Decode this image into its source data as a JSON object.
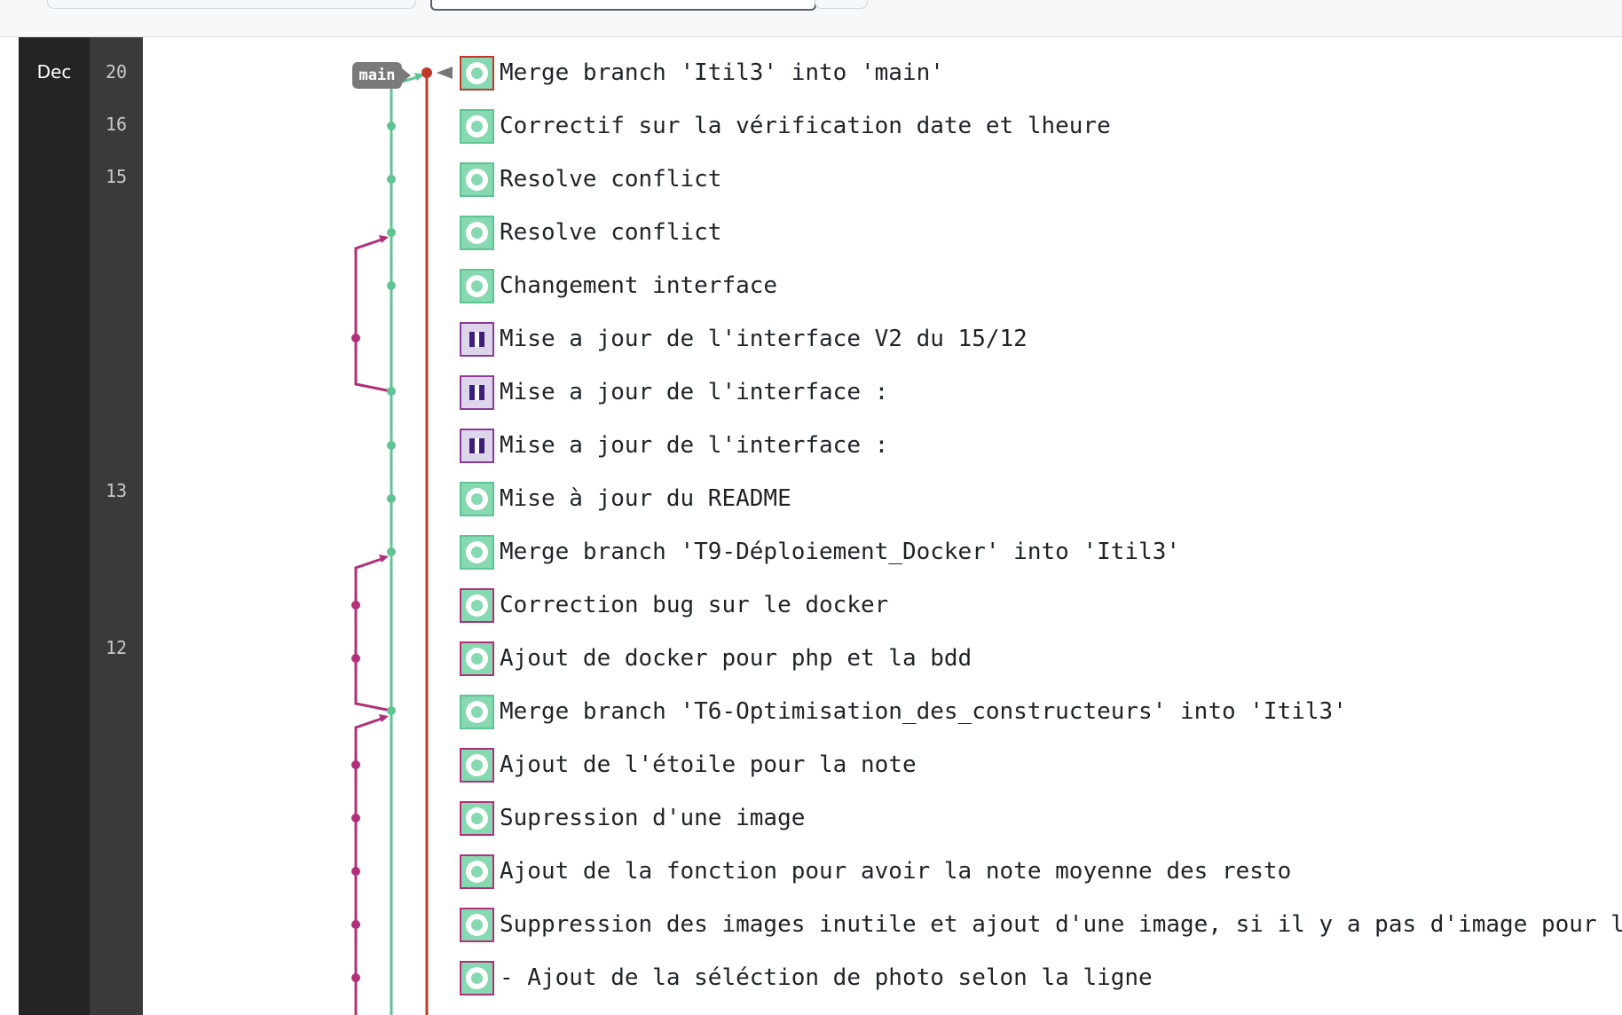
{
  "branch_label": "main",
  "dates": {
    "month": "Dec",
    "days": [
      "20",
      "16",
      "15",
      "13",
      "12"
    ]
  },
  "commits": [
    {
      "message": "Merge branch 'Itil3' into 'main'"
    },
    {
      "message": "Correctif sur la vérification date et lheure"
    },
    {
      "message": "Resolve conflict"
    },
    {
      "message": "Resolve conflict"
    },
    {
      "message": "Changement interface"
    },
    {
      "message": "Mise a jour de l'interface V2 du 15/12"
    },
    {
      "message": "Mise a jour de l'interface :"
    },
    {
      "message": "Mise a jour de l'interface :"
    },
    {
      "message": "Mise à jour du README"
    },
    {
      "message": "Merge branch 'T9-Déploiement_Docker' into 'Itil3'"
    },
    {
      "message": "Correction bug sur le docker"
    },
    {
      "message": "Ajout de docker pour php et la bdd"
    },
    {
      "message": "Merge branch 'T6-Optimisation_des_constructeurs' into 'Itil3'"
    },
    {
      "message": "Ajout de l'étoile pour la note"
    },
    {
      "message": "Supression d'une image"
    },
    {
      "message": "Ajout de la fonction pour avoir la note moyenne des resto"
    },
    {
      "message": "Suppression des images inutile et ajout d'une image, si il y a pas d'image pour le"
    },
    {
      "message": "- Ajout de la séléction de photo selon la ligne"
    }
  ],
  "colors": {
    "main_line": "#c0392b",
    "itil3_line": "#5fc394",
    "feature_line": "#b0307a"
  }
}
